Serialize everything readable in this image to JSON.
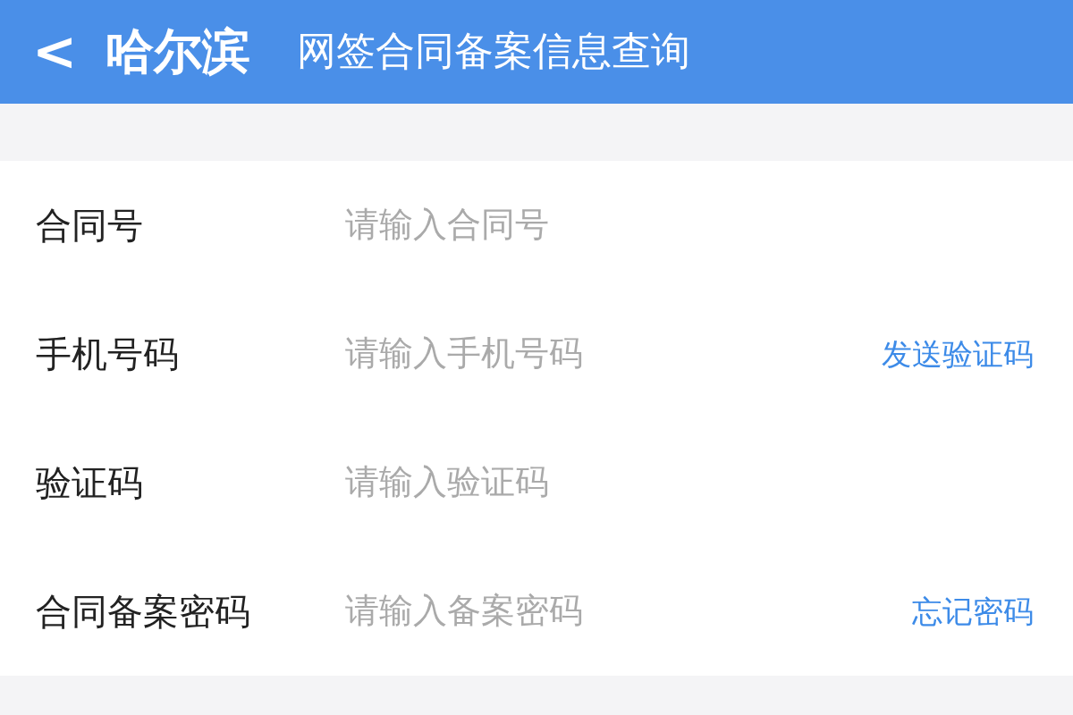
{
  "header": {
    "back": "<",
    "city": "哈尔滨",
    "title": "网签合同备案信息查询"
  },
  "fields": [
    {
      "label": "合同号",
      "placeholder": "请输入合同号"
    },
    {
      "label": "手机号码",
      "placeholder": "请输入手机号码",
      "action": "发送验证码"
    },
    {
      "label": "验证码",
      "placeholder": "请输入验证码"
    },
    {
      "label": "合同备案密码",
      "placeholder": "请输入备案密码",
      "action": "忘记密码"
    }
  ]
}
